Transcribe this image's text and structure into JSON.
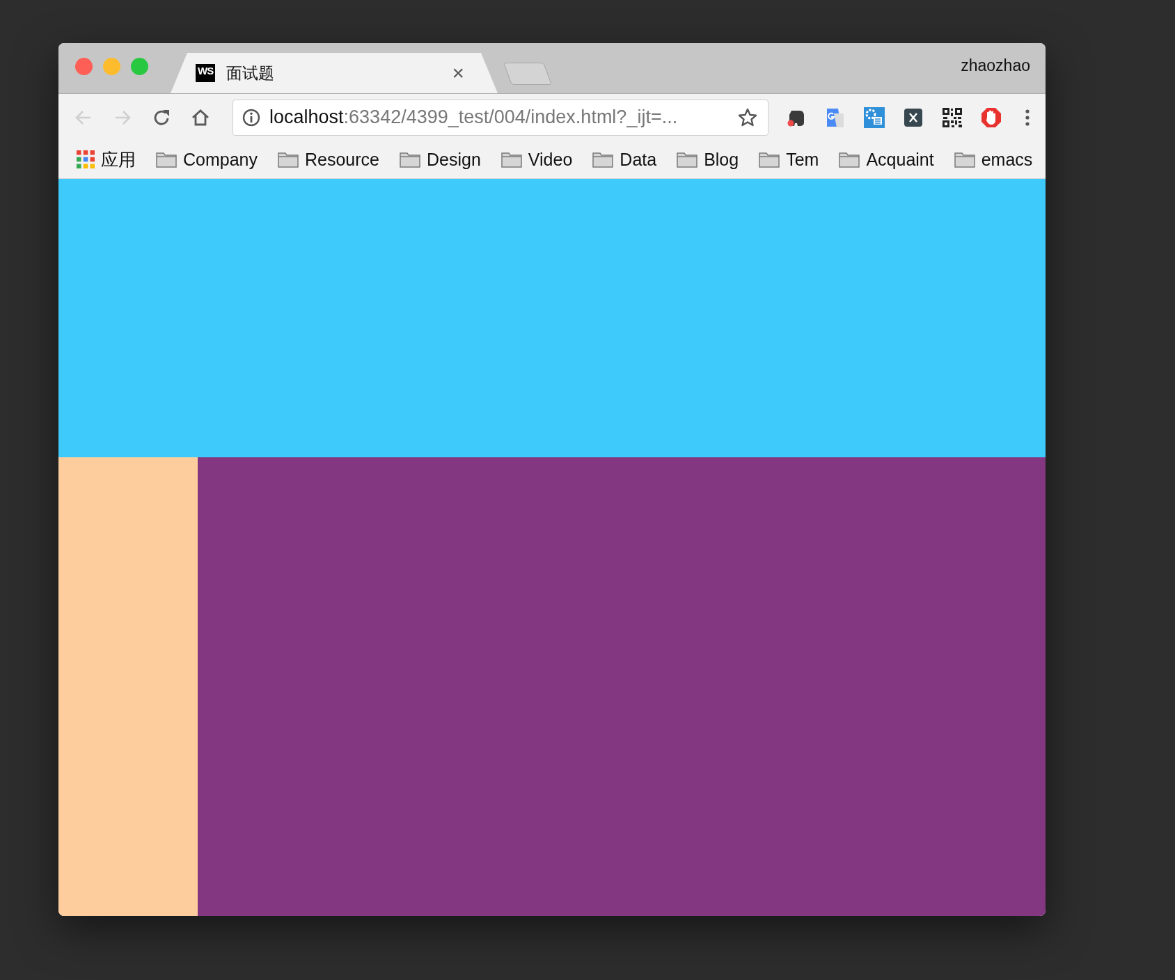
{
  "tabs": [
    {
      "favicon_text": "WS",
      "title": "面试题",
      "close": "×",
      "selected": true
    }
  ],
  "profile": "zhaozhao",
  "address_bar": {
    "host": "localhost",
    "path": ":63342/4399_test/004/index.html?_ijt=..."
  },
  "bookmarks": [
    {
      "label": "应用",
      "kind": "apps"
    },
    {
      "label": "Company",
      "kind": "folder"
    },
    {
      "label": "Resource",
      "kind": "folder"
    },
    {
      "label": "Design",
      "kind": "folder"
    },
    {
      "label": "Video",
      "kind": "folder"
    },
    {
      "label": "Data",
      "kind": "folder"
    },
    {
      "label": "Blog",
      "kind": "folder"
    },
    {
      "label": "Tem",
      "kind": "folder"
    },
    {
      "label": "Acquaint",
      "kind": "folder"
    },
    {
      "label": "emacs",
      "kind": "folder"
    }
  ]
}
